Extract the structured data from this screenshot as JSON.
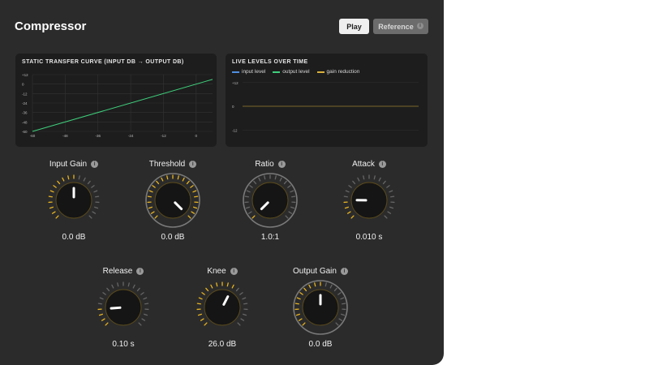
{
  "app": {
    "title": "Compressor"
  },
  "toolbar": {
    "play_label": "Play",
    "reference_label": "Reference",
    "info_glyph": "i"
  },
  "transfer_curve": {
    "title": "STATIC TRANSFER CURVE  (INPUT DB → OUTPUT DB)",
    "y_ticks": [
      "+12",
      "0",
      "-12",
      "-24",
      "-36",
      "-48",
      "-60"
    ],
    "x_ticks": [
      "-60",
      "-48",
      "-36",
      "-24",
      "-12",
      "0"
    ],
    "curve_color": "#3fcf7c"
  },
  "live_levels": {
    "title": "LIVE LEVELS OVER TIME",
    "legend": [
      {
        "label": "input level",
        "color": "#4f8fe0"
      },
      {
        "label": "output level",
        "color": "#3fcf7c"
      },
      {
        "label": "gain reduction",
        "color": "#d9b13a"
      }
    ],
    "y_ticks": [
      "+12",
      "0",
      "-12"
    ]
  },
  "chart_data": [
    {
      "type": "line",
      "title": "STATIC TRANSFER CURVE  (INPUT DB → OUTPUT DB)",
      "xlim": [
        -60,
        6
      ],
      "ylim": [
        -60,
        12
      ],
      "series": [
        {
          "x": [
            -60,
            6
          ],
          "y": [
            -60,
            6
          ]
        }
      ]
    },
    {
      "type": "line",
      "title": "LIVE LEVELS OVER TIME",
      "ylim": [
        -16,
        16
      ],
      "series": [
        {
          "name": "input level",
          "values": []
        },
        {
          "name": "output level",
          "values": []
        },
        {
          "name": "gain reduction",
          "values": [
            0,
            0
          ]
        }
      ]
    }
  ],
  "knobs": [
    {
      "label": "Input Gain",
      "value": "0.0 dB",
      "level": 0.5
    },
    {
      "label": "Threshold",
      "value": "0.0 dB",
      "level": 1.0
    },
    {
      "label": "Ratio",
      "value": "1.0:1",
      "level": 0.0
    },
    {
      "label": "Attack",
      "value": "0.010 s",
      "level": 0.17
    },
    {
      "label": "Release",
      "value": "0.10 s",
      "level": 0.15
    },
    {
      "label": "Knee",
      "value": "26.0 dB",
      "level": 0.6
    },
    {
      "label": "Output Gain",
      "value": "0.0 dB",
      "level": 0.5
    }
  ],
  "colors": {
    "accent": "#e8b420",
    "panel": "#2b2b2b",
    "card": "#1d1d1d"
  }
}
